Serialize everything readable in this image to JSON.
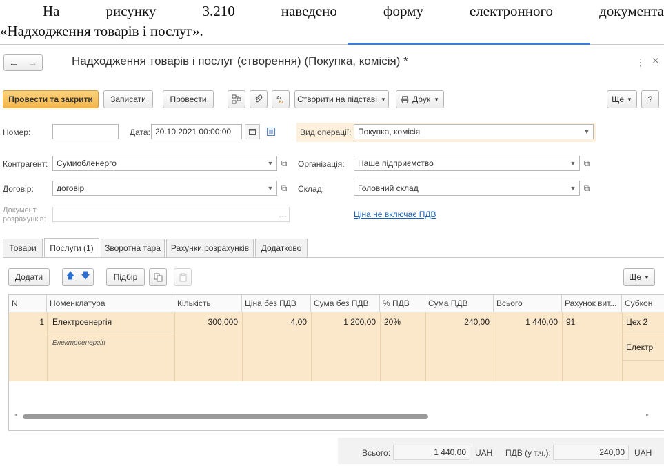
{
  "intro": {
    "line1": [
      "На",
      "рисунку",
      "3.210",
      "наведено",
      "форму",
      "електронного",
      "документа"
    ],
    "line2": "«Надходження товарів і послуг»."
  },
  "window": {
    "title": "Надходження товарів і послуг (створення) (Покупка, комісія) *",
    "nav_back": "←",
    "nav_forward": "→",
    "menu_glyph": "⋮",
    "close_glyph": "×"
  },
  "toolbar": {
    "post_close": "Провести та закрити",
    "save": "Записати",
    "post": "Провести",
    "create_based": "Створити на підставі",
    "print": "Друк",
    "more": "Ще",
    "help": "?"
  },
  "form": {
    "number_label": "Номер:",
    "number_value": "",
    "date_label": "Дата:",
    "date_value": "20.10.2021 00:00:00",
    "operation_label": "Вид операції:",
    "operation_value": "Покупка, комісія",
    "counterparty_label": "Контрагент:",
    "counterparty_value": "Сумиобленерго",
    "organization_label": "Організація:",
    "organization_value": "Наше підприємство",
    "contract_label": "Договір:",
    "contract_value": "договір",
    "warehouse_label": "Склад:",
    "warehouse_value": "Головний склад",
    "settlement_doc_label_1": "Документ",
    "settlement_doc_label_2": "розрахунків:",
    "settlement_doc_value": "",
    "vat_link": "Ціна не включає ПДВ"
  },
  "tabs": [
    {
      "label": "Товари",
      "active": false
    },
    {
      "label": "Послуги (1)",
      "active": true
    },
    {
      "label": "Зворотна тара",
      "active": false
    },
    {
      "label": "Рахунки розрахунків",
      "active": false
    },
    {
      "label": "Додатково",
      "active": false
    }
  ],
  "table_toolbar": {
    "add": "Додати",
    "pick": "Підбір",
    "more": "Ще"
  },
  "table": {
    "columns": [
      "N",
      "Номенклатура",
      "Кількість",
      "Ціна без ПДВ",
      "Сума без ПДВ",
      "% ПДВ",
      "Сума ПДВ",
      "Всього",
      "Рахунок вит...",
      "Субкон"
    ],
    "rows": [
      {
        "n": "1",
        "item": "Електроенергія",
        "item_sub": "Електроенергія",
        "qty": "300,000",
        "price": "4,00",
        "amount": "1 200,00",
        "vat_rate": "20%",
        "vat_sum": "240,00",
        "total": "1 440,00",
        "account": "91",
        "subconto_1": "Цех 2",
        "subconto_2": "Електр"
      }
    ]
  },
  "footer": {
    "total_label": "Всього:",
    "total_value": "1 440,00",
    "currency": "UAH",
    "vat_label": "ПДВ (у т.ч.):",
    "vat_value": "240,00",
    "vat_currency": "UAH"
  },
  "colors": {
    "primary_button": "#f3b54c",
    "row_highlight": "#fbe7c9",
    "link": "#1a63b8",
    "operation_highlight": "#fdf0dc"
  }
}
